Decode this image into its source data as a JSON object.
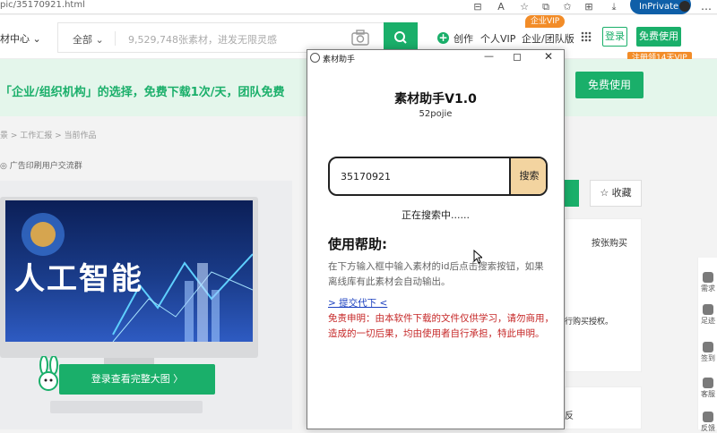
{
  "browser": {
    "url": "pic/35170921.html",
    "profile_label": "InPrivate",
    "more_label": "…"
  },
  "header": {
    "category_menu": "材中心 ⌄",
    "search_scope": "全部 ⌄",
    "search_placeholder": "9,529,748张素材，进发无限灵感",
    "create_label": "创作",
    "personal_vip": "个人VIP",
    "enterprise_label": "企业/团队版",
    "enterprise_badge": "企业VIP",
    "login_label": "登录",
    "free_use_label": "免费使用",
    "register_badge": "注册领14天VIP"
  },
  "promo": {
    "text": "「企业/组织机构」的选择，免费下载1次/天，团队免费",
    "button_label": "免费使用"
  },
  "page": {
    "breadcrumb": "景 > 工作汇报 > 当前作品",
    "group_link": "◎ 广告印刷用户交流群",
    "preview_text": "人工智能",
    "login_full_button": "登录查看完整大图 〉",
    "collect_label": "☆ 收藏",
    "side_text_1": "按张购买",
    "side_text_2": "行购买授权。",
    "side_text_3": "反"
  },
  "float_bar": {
    "items": [
      "需求",
      "足迹",
      "签到",
      "客服",
      "反馈"
    ]
  },
  "dialog": {
    "window_title": "素材助手",
    "app_title": "素材助手V1.0",
    "app_subtitle": "52pojie",
    "input_value": "35170921",
    "search_button": "搜索",
    "status": "正在搜索中......",
    "help_title": "使用帮助:",
    "help_desc": "在下方输入框中输入素材的id后点击搜索按钮，如果离线库有此素材会自动输出。",
    "submit_link": "> 提交代下 <",
    "disclaimer": "免责申明：由本软件下载的文件仅供学习，请勿商用，造成的一切后果，均由使用者自行承担，特此申明。"
  },
  "colors": {
    "brand_green": "#1aaf6a",
    "promo_bg": "#e4f6eb",
    "badge_orange": "#f28c28",
    "search_button_bg": "#f3d4a0",
    "disclaimer_red": "#c62828",
    "link_blue": "#1a3fbf"
  }
}
